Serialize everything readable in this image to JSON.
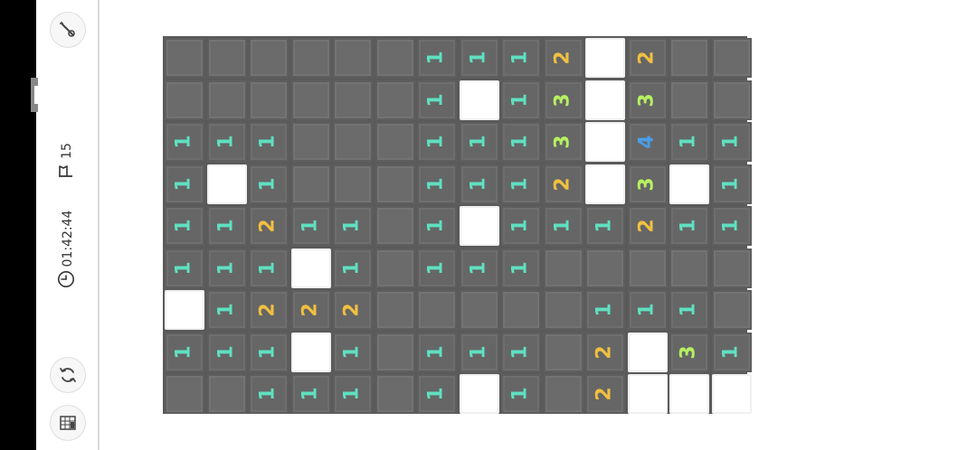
{
  "sidebar": {
    "hint_icon": "magic-wand-icon",
    "flags_icon": "flag-icon",
    "flags_remaining": "15",
    "timer_icon": "clock-icon",
    "timer": "01:42:44",
    "restart_icon": "refresh-icon",
    "menu_icon": "game-board-icon"
  },
  "colors": {
    "n1": "#5fe0c0",
    "n2": "#f0c040",
    "n3": "#b6f060",
    "n4": "#4d9de8"
  },
  "board": {
    "rows": 9,
    "cols": 14,
    "legend": "U = unrevealed, E = revealed empty, digits = revealed number",
    "cells": [
      [
        "U",
        "U",
        "U",
        "U",
        "U",
        "U",
        "1",
        "1",
        "1",
        "2",
        "E",
        "2",
        "U",
        "U"
      ],
      [
        "U",
        "U",
        "U",
        "U",
        "U",
        "U",
        "1",
        "E",
        "1",
        "3",
        "E",
        "3",
        "U",
        "U"
      ],
      [
        "1",
        "1",
        "1",
        "U",
        "U",
        "U",
        "1",
        "1",
        "1",
        "3",
        "E",
        "4",
        "1",
        "1"
      ],
      [
        "1",
        "E",
        "1",
        "U",
        "U",
        "U",
        "1",
        "1",
        "1",
        "2",
        "E",
        "3",
        "E",
        "1"
      ],
      [
        "1",
        "1",
        "2",
        "1",
        "1",
        "U",
        "1",
        "E",
        "1",
        "1",
        "1",
        "2",
        "1",
        "1"
      ],
      [
        "1",
        "1",
        "1",
        "E",
        "1",
        "U",
        "1",
        "1",
        "1",
        "U",
        "U",
        "U",
        "U",
        "U"
      ],
      [
        "E",
        "1",
        "2",
        "2",
        "2",
        "U",
        "U",
        "U",
        "U",
        "U",
        "1",
        "1",
        "1",
        "U"
      ],
      [
        "1",
        "1",
        "1",
        "E",
        "1",
        "U",
        "1",
        "1",
        "1",
        "U",
        "2",
        "E",
        "3",
        "1"
      ],
      [
        "U",
        "U",
        "1",
        "1",
        "1",
        "U",
        "1",
        "E",
        "1",
        "U",
        "2",
        "E",
        "E",
        "E"
      ]
    ]
  }
}
